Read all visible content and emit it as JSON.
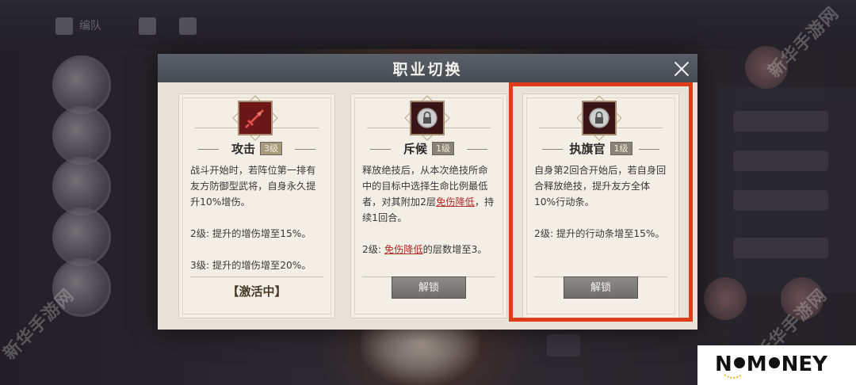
{
  "dialog": {
    "title": "职业切换",
    "cards": [
      {
        "name": "攻击",
        "level": "3级",
        "icon": "sword-icon",
        "desc": [
          "战斗开始时，若阵位第一排有友方防御型武将，自身永久提升10%增伤。",
          "2级: 提升的增伤增至15%。",
          "3级: 提升的增伤增至20%。"
        ],
        "status": "【激活中】"
      },
      {
        "name": "斥候",
        "level": "1级",
        "icon": "lock-icon",
        "desc_parts": {
          "p1_a": "释放绝技后，从本次绝技所命中的目标中选择生命比例最低者，对其附加2层",
          "p1_hl": "免伤降低",
          "p1_b": "，持续1回合。",
          "p2_a": "2级: ",
          "p2_hl": "免伤降低",
          "p2_b": "的层数增至3。"
        },
        "button": "解锁"
      },
      {
        "name": "执旗官",
        "level": "1级",
        "icon": "lock-icon",
        "desc": [
          "自身第2回合开始后，若自身回合释放绝技，提升友方全体10%行动条。",
          "2级: 提升的行动条增至15%。"
        ],
        "button": "解锁"
      }
    ]
  },
  "background": {
    "topbar_label": "编队"
  },
  "watermark": "新华手游网",
  "logo": "NOMONEY",
  "colors": {
    "highlight_frame": "#dd3d1b",
    "keyword": "#b52a25",
    "header": "#4f535a"
  }
}
